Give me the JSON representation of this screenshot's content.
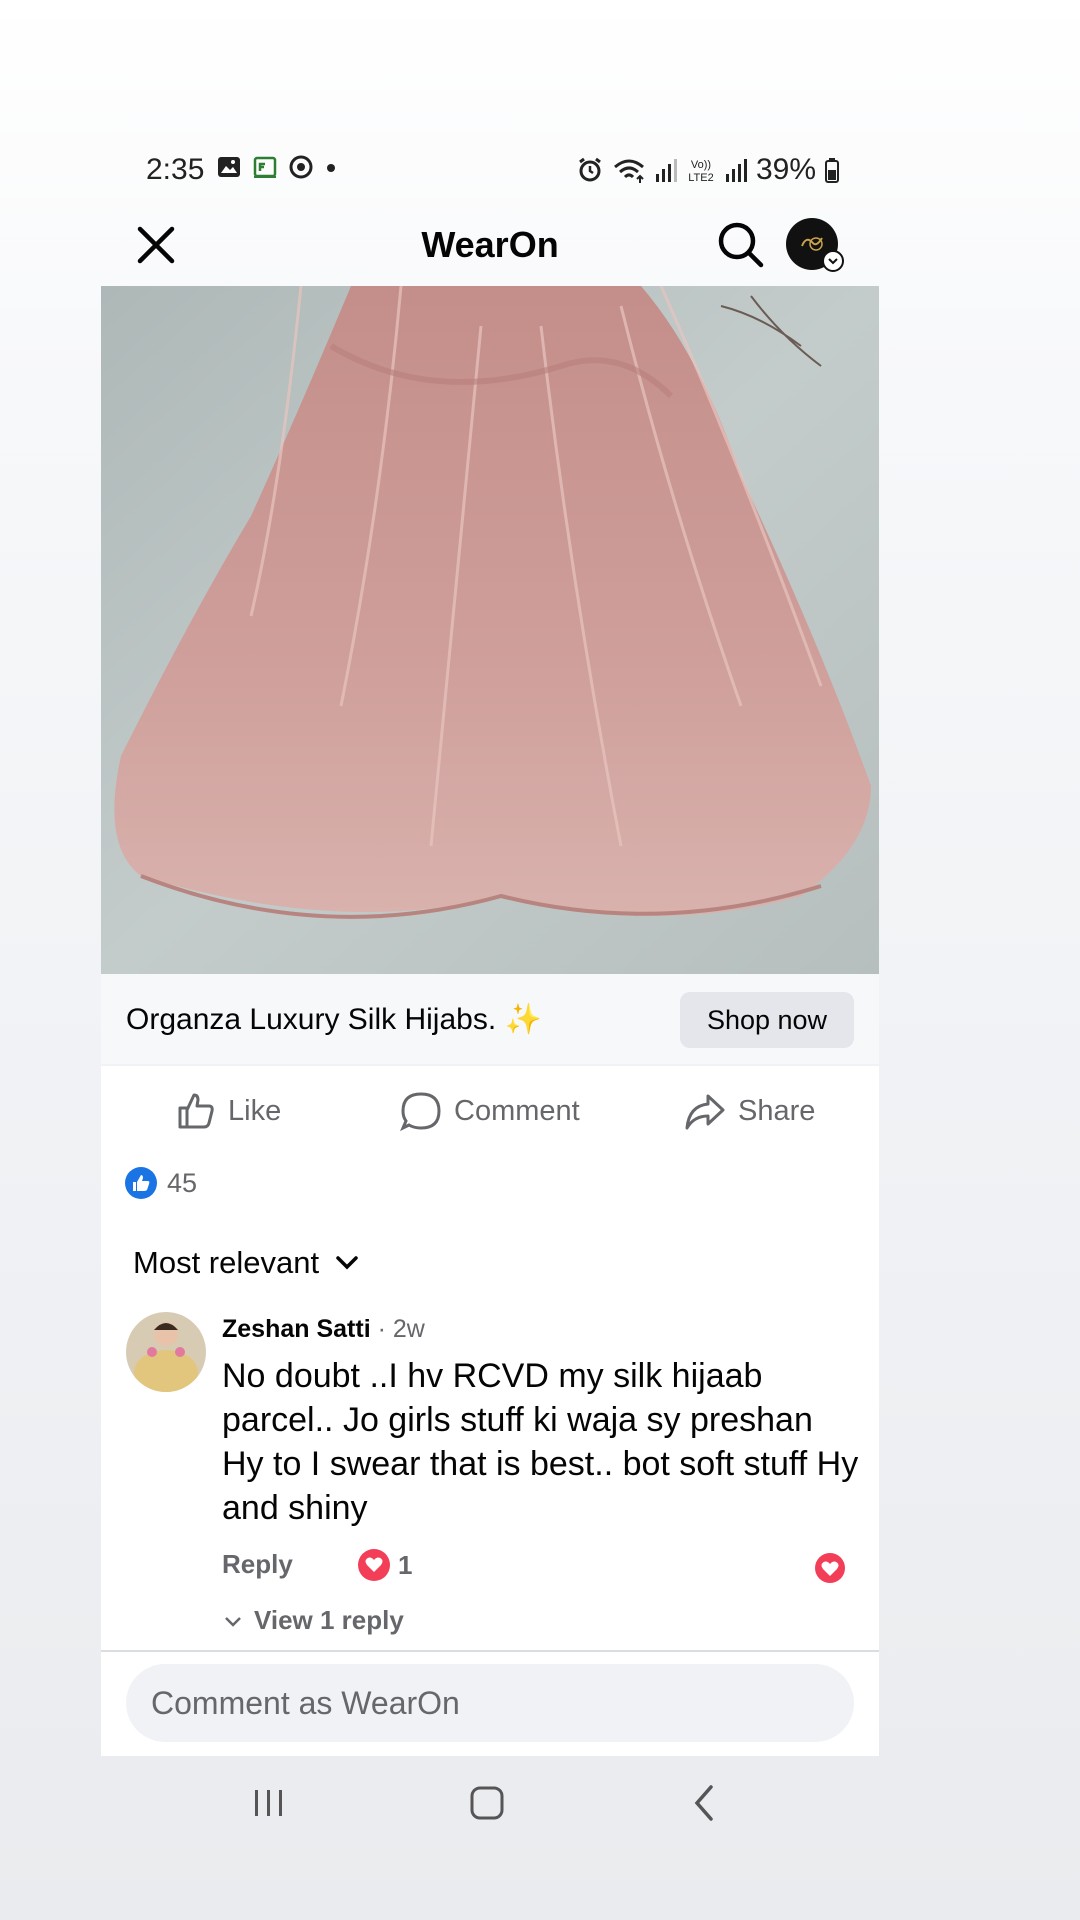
{
  "status_bar": {
    "time": "2:35",
    "battery": "39%"
  },
  "header": {
    "title": "WearOn"
  },
  "ad": {
    "caption": "Organza Luxury Silk Hijabs. ✨",
    "cta_label": "Shop now"
  },
  "actions": {
    "like": "Like",
    "comment": "Comment",
    "share": "Share"
  },
  "reactions": {
    "like_count": "45"
  },
  "comments": {
    "sort_label": "Most relevant",
    "items": [
      {
        "author": "Zeshan Satti",
        "time": "· 2w",
        "text": "No doubt ..I hv RCVD my silk hijaab parcel.. Jo girls stuff ki waja sy preshan Hy to I swear that is best.. bot soft stuff Hy and shiny",
        "reply_label": "Reply",
        "reaction_count": "1",
        "view_replies_label": "View 1 reply"
      }
    ]
  },
  "comment_composer": {
    "placeholder": "Comment as WearOn"
  },
  "colors": {
    "facebook_blue": "#1b74e4",
    "love_red": "#f33e58",
    "muted_text": "#65676b",
    "chip_gray": "#e4e6eb",
    "fabric_pink": "#c99a96"
  }
}
